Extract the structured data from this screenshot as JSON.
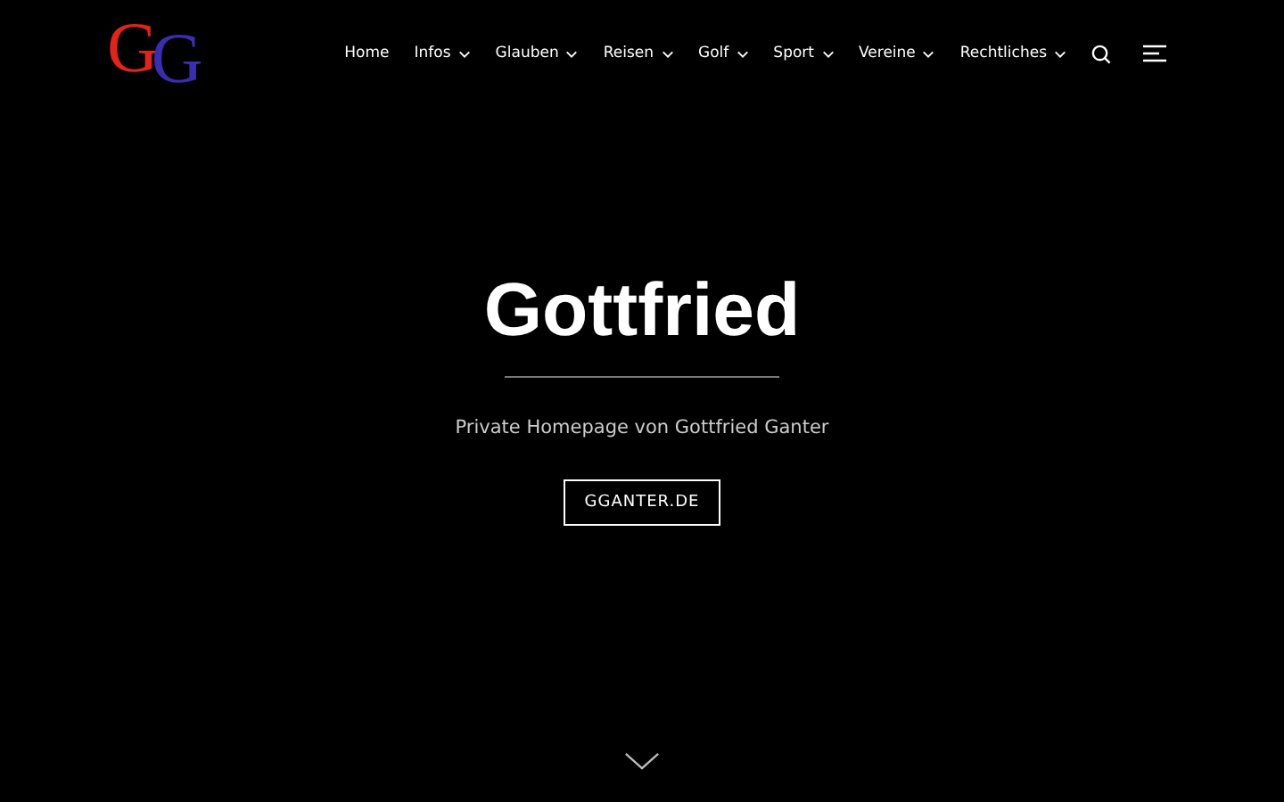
{
  "logo": [
    {
      "text": "G",
      "color": "#e2231a"
    },
    {
      "text": "G",
      "color": "#3a2db0"
    }
  ],
  "nav": [
    {
      "label": "Home",
      "has_submenu": false
    },
    {
      "label": "Infos",
      "has_submenu": true
    },
    {
      "label": "Glauben",
      "has_submenu": true
    },
    {
      "label": "Reisen",
      "has_submenu": true
    },
    {
      "label": "Golf",
      "has_submenu": true
    },
    {
      "label": "Sport",
      "has_submenu": true
    },
    {
      "label": "Vereine",
      "has_submenu": true
    },
    {
      "label": "Rechtliches",
      "has_submenu": true
    }
  ],
  "hero": {
    "title": "Gottfried",
    "subtitle": "Private Homepage von Gottfried Ganter",
    "button": "GGANTER.DE"
  }
}
